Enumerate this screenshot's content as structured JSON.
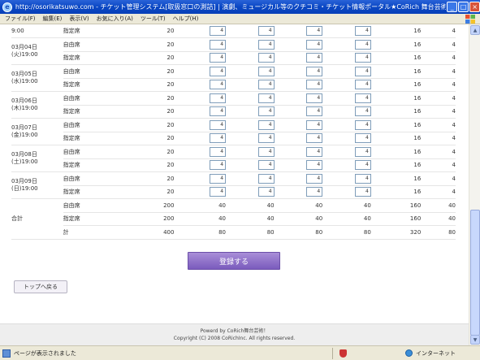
{
  "window": {
    "title": "http://osorikatsuwo.com - チケット管理システム[取扱窓口の測詰] | 演劇、ミュージカル等のクチコミ・チケット情報ポータル★CoRich 舞台芸術！ - Micros...",
    "minimize": "_",
    "maximize": "□",
    "close": "×"
  },
  "menu": [
    "ファイル(F)",
    "編集(E)",
    "表示(V)",
    "お気に入り(A)",
    "ツール(T)",
    "ヘルプ(H)"
  ],
  "table": {
    "partial_top": {
      "date": "9:00",
      "type": "指定席",
      "values": [
        "20",
        "4",
        "4",
        "4",
        "4",
        "16",
        "4"
      ]
    },
    "days": [
      {
        "date": "03月04日(火)19:00",
        "rows": [
          {
            "type": "自由席",
            "values": [
              "20",
              "4",
              "4",
              "4",
              "4",
              "16",
              "4"
            ]
          },
          {
            "type": "指定席",
            "values": [
              "20",
              "4",
              "4",
              "4",
              "4",
              "16",
              "4"
            ]
          }
        ]
      },
      {
        "date": "03月05日(水)19:00",
        "rows": [
          {
            "type": "自由席",
            "values": [
              "20",
              "4",
              "4",
              "4",
              "4",
              "16",
              "4"
            ]
          },
          {
            "type": "指定席",
            "values": [
              "20",
              "4",
              "4",
              "4",
              "4",
              "16",
              "4"
            ]
          }
        ]
      },
      {
        "date": "03月06日(木)19:00",
        "rows": [
          {
            "type": "自由席",
            "values": [
              "20",
              "4",
              "4",
              "4",
              "4",
              "16",
              "4"
            ]
          },
          {
            "type": "指定席",
            "values": [
              "20",
              "4",
              "4",
              "4",
              "4",
              "16",
              "4"
            ]
          }
        ]
      },
      {
        "date": "03月07日(金)19:00",
        "rows": [
          {
            "type": "自由席",
            "values": [
              "20",
              "4",
              "4",
              "4",
              "4",
              "16",
              "4"
            ]
          },
          {
            "type": "指定席",
            "values": [
              "20",
              "4",
              "4",
              "4",
              "4",
              "16",
              "4"
            ]
          }
        ]
      },
      {
        "date": "03月08日(土)19:00",
        "rows": [
          {
            "type": "自由席",
            "values": [
              "20",
              "4",
              "4",
              "4",
              "4",
              "16",
              "4"
            ]
          },
          {
            "type": "指定席",
            "values": [
              "20",
              "4",
              "4",
              "4",
              "4",
              "16",
              "4"
            ]
          }
        ]
      },
      {
        "date": "03月09日(日)19:00",
        "rows": [
          {
            "type": "自由席",
            "values": [
              "20",
              "4",
              "4",
              "4",
              "4",
              "16",
              "4"
            ]
          },
          {
            "type": "指定席",
            "values": [
              "20",
              "4",
              "4",
              "4",
              "4",
              "16",
              "4"
            ]
          }
        ]
      }
    ],
    "total": {
      "label": "合計",
      "rows": [
        {
          "type": "自由席",
          "values": [
            "200",
            "40",
            "40",
            "40",
            "40",
            "160",
            "40"
          ]
        },
        {
          "type": "指定席",
          "values": [
            "200",
            "40",
            "40",
            "40",
            "40",
            "160",
            "40"
          ]
        },
        {
          "type": "計",
          "values": [
            "400",
            "80",
            "80",
            "80",
            "80",
            "320",
            "80"
          ]
        }
      ]
    }
  },
  "buttons": {
    "register": "登録する",
    "back_top": "トップへ戻る"
  },
  "footer": {
    "line1": "Powerd by CoRich舞台芸術！",
    "line2": "Copyright (C) 2008 CoRichInc. All rights reserved."
  },
  "status": {
    "text": "ページが表示されました",
    "zone": "インターネット"
  },
  "colors": {
    "titlebar": "#0a47c4",
    "register_button": "#8a6cc8",
    "input_border": "#7f9db9"
  }
}
